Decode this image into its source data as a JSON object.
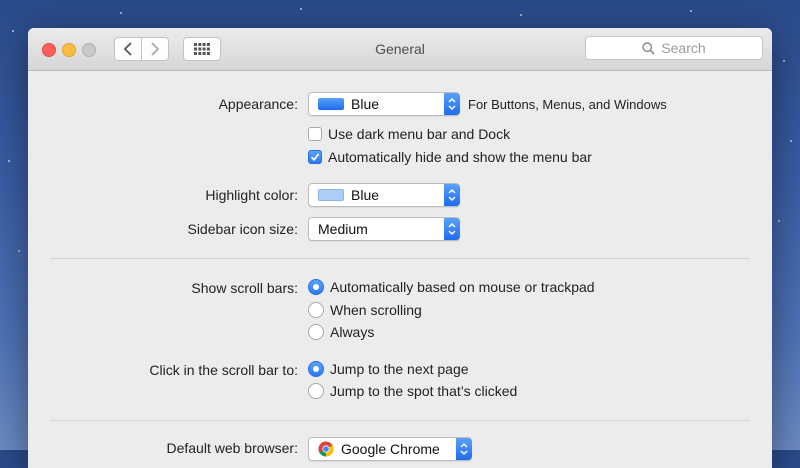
{
  "window": {
    "title": "General",
    "search_placeholder": "Search"
  },
  "appearance": {
    "label": "Appearance:",
    "value": "Blue",
    "swatch_color": "#2a76f0",
    "note": "For Buttons, Menus, and Windows"
  },
  "checkboxes": [
    {
      "label": "Use dark menu bar and Dock",
      "checked": false
    },
    {
      "label": "Automatically hide and show the menu bar",
      "checked": true
    }
  ],
  "highlight": {
    "label": "Highlight color:",
    "value": "Blue",
    "swatch_color": "#aecdf7"
  },
  "sidebar_icon": {
    "label": "Sidebar icon size:",
    "value": "Medium"
  },
  "scroll_bars": {
    "label": "Show scroll bars:",
    "options": [
      "Automatically based on mouse or trackpad",
      "When scrolling",
      "Always"
    ],
    "selected": 0
  },
  "click_scroll": {
    "label": "Click in the scroll bar to:",
    "options": [
      "Jump to the next page",
      "Jump to the spot that’s clicked"
    ],
    "selected": 0
  },
  "browser": {
    "label": "Default web browser:",
    "value": "Google Chrome"
  },
  "colors": {
    "accent": "#2a77f5",
    "close": "#fc605c",
    "minimize": "#fdbc40"
  }
}
